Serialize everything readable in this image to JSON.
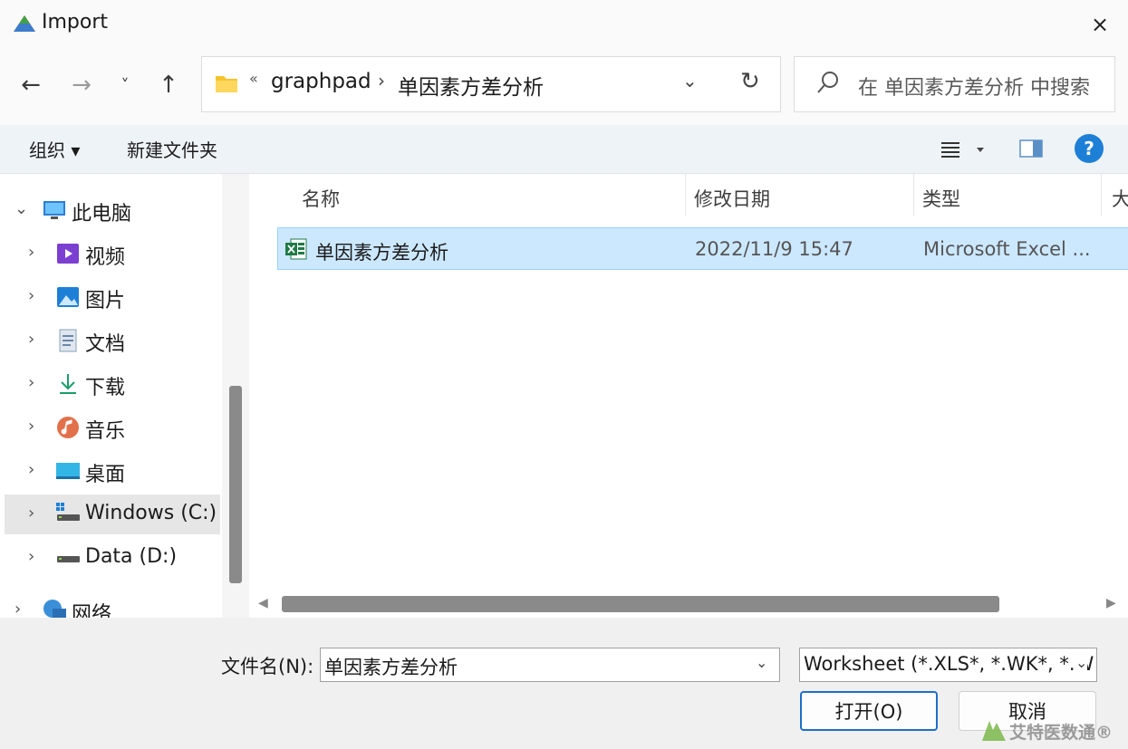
{
  "window": {
    "title": "Import",
    "close_icon": "×"
  },
  "nav": {
    "back_icon": "←",
    "forward_icon": "→",
    "recent_icon": "˅",
    "up_icon": "↑",
    "address": {
      "overflow": "«",
      "crumbs": [
        "graphpad",
        "单因素方差分析"
      ],
      "separator": "›",
      "dropdown_icon": "⌄",
      "refresh_icon": "↻"
    },
    "search_placeholder": "在 单因素方差分析 中搜索"
  },
  "commands": {
    "organize": "组织 ▾",
    "new_folder": "新建文件夹",
    "help": "?"
  },
  "sidebar": {
    "items": [
      {
        "label": "此电脑",
        "icon": "pc-icon",
        "chev": "⌄"
      },
      {
        "label": "视频",
        "icon": "video-icon",
        "chev": "›"
      },
      {
        "label": "图片",
        "icon": "pictures-icon",
        "chev": "›"
      },
      {
        "label": "文档",
        "icon": "documents-icon",
        "chev": "›"
      },
      {
        "label": "下载",
        "icon": "download-icon",
        "chev": "›"
      },
      {
        "label": "音乐",
        "icon": "music-icon",
        "chev": "›"
      },
      {
        "label": "桌面",
        "icon": "desktop-icon",
        "chev": "›"
      },
      {
        "label": "Windows (C:)",
        "icon": "drive-c-icon",
        "chev": "›"
      },
      {
        "label": "Data (D:)",
        "icon": "drive-d-icon",
        "chev": "›"
      },
      {
        "label": "网络",
        "icon": "network-icon",
        "chev": "›"
      }
    ]
  },
  "filelist": {
    "columns": [
      "名称",
      "修改日期",
      "类型",
      "大"
    ],
    "sort_indicator": "˄",
    "rows": [
      {
        "name": "单因素方差分析",
        "modified": "2022/11/9 15:47",
        "type": "Microsoft Excel ...",
        "icon": "excel-icon"
      }
    ]
  },
  "footer": {
    "filename_label": "文件名(N):",
    "filename_value": "单因素方差分析",
    "filter_value": "Worksheet (*.XLS*, *.WK*, *.W",
    "dropdown_icon": "⌄",
    "open_label": "打开(O)",
    "cancel_label": "取消",
    "watermark": "艾特医数通®"
  },
  "colors": {
    "accent": "#1e7fd6",
    "selection": "#cce8ff",
    "excel": "#1f7a45"
  }
}
